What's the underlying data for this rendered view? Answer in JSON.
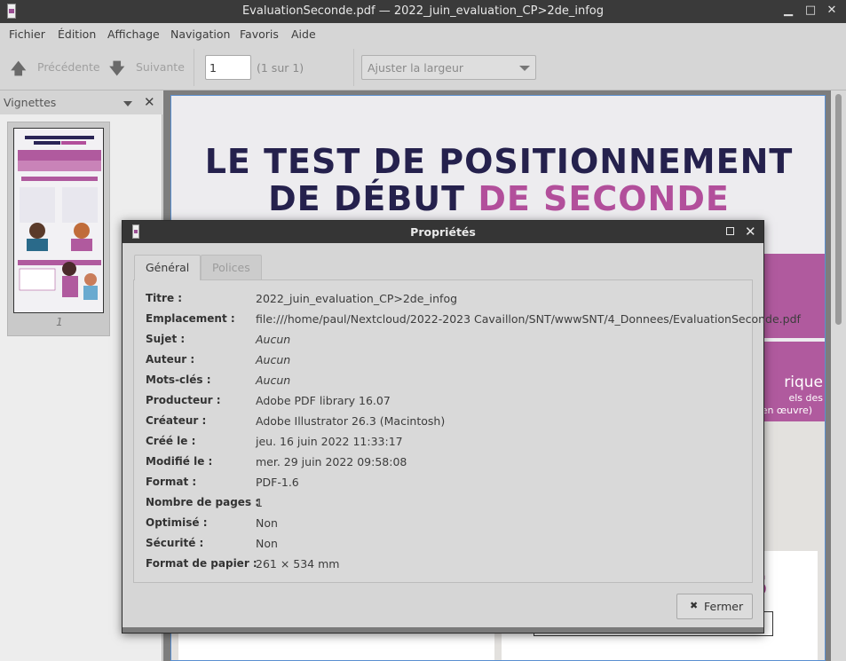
{
  "window": {
    "title": "EvaluationSeconde.pdf — 2022_juin_evaluation_CP>2de_infog",
    "minimize_glyph": "▁",
    "maximize_glyph": "□",
    "close_glyph": "✕"
  },
  "menu": [
    "Fichier",
    "Édition",
    "Affichage",
    "Navigation",
    "Favoris",
    "Aide"
  ],
  "toolbar": {
    "prev_label": "Précédente",
    "next_label": "Suivante",
    "page_value": "1",
    "page_count": "(1 sur 1)",
    "zoom_value": "Ajuster la largeur"
  },
  "sidebar": {
    "title": "Vignettes",
    "thumbnail_number": "1"
  },
  "document": {
    "heading_line1": "LE TEST DE POSITIONNEMENT",
    "heading_line2_a": "DE DÉBUT ",
    "heading_line2_b": "DE SECONDE",
    "accent_color": "#b24f9b",
    "navy_color": "#25214d",
    "fragment_1": "rique",
    "fragment_2": "els des",
    "fragment_3": "en œuvre)",
    "fragment_4": "S"
  },
  "dialog": {
    "title": "Propriétés",
    "tabs": [
      "Général",
      "Polices"
    ],
    "properties": [
      {
        "key": "Titre :",
        "value": "2022_juin_evaluation_CP>2de_infog",
        "italic": false
      },
      {
        "key": "Emplacement :",
        "value": "file:///home/paul/Nextcloud/2022-2023 Cavaillon/SNT/wwwSNT/4_Donnees/EvaluationSeconde.pdf",
        "italic": false
      },
      {
        "key": "Sujet :",
        "value": "Aucun",
        "italic": true
      },
      {
        "key": "Auteur :",
        "value": "Aucun",
        "italic": true
      },
      {
        "key": "Mots-clés :",
        "value": "Aucun",
        "italic": true
      },
      {
        "key": "Producteur :",
        "value": "Adobe PDF library 16.07",
        "italic": false
      },
      {
        "key": "Créateur :",
        "value": "Adobe Illustrator 26.3 (Macintosh)",
        "italic": false
      },
      {
        "key": "Créé le :",
        "value": "jeu. 16 juin 2022 11:33:17",
        "italic": false
      },
      {
        "key": "Modifié le :",
        "value": "mer. 29 juin 2022 09:58:08",
        "italic": false
      },
      {
        "key": "Format :",
        "value": "PDF-1.6",
        "italic": false
      },
      {
        "key": "Nombre de pages :",
        "value": "1",
        "italic": false
      },
      {
        "key": "Optimisé :",
        "value": "Non",
        "italic": false
      },
      {
        "key": "Sécurité :",
        "value": "Non",
        "italic": false
      },
      {
        "key": "Format de papier :",
        "value": "261 × 534 mm",
        "italic": false
      }
    ],
    "close_button": "Fermer"
  }
}
